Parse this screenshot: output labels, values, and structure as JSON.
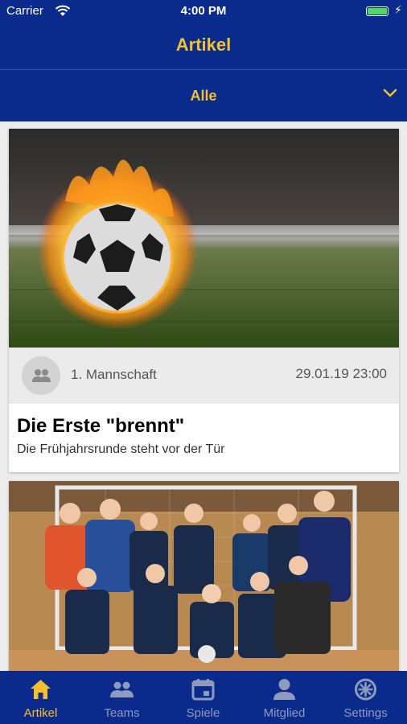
{
  "status": {
    "carrier": "Carrier",
    "time": "4:00 PM",
    "battery_level": 1.0
  },
  "nav": {
    "title": "Artikel"
  },
  "filter": {
    "selected": "Alle"
  },
  "articles": [
    {
      "team": "1. Mannschaft",
      "date": "29.01.19 23:00",
      "title": "Die Erste \"brennt\"",
      "subtitle": "Die Frühjahrsrunde steht vor der Tür"
    }
  ],
  "tabs": [
    {
      "label": "Artikel",
      "icon": "home-icon",
      "active": true
    },
    {
      "label": "Teams",
      "icon": "teams-icon",
      "active": false
    },
    {
      "label": "Spiele",
      "icon": "calendar-icon",
      "active": false
    },
    {
      "label": "Mitglied",
      "icon": "person-icon",
      "active": false
    },
    {
      "label": "Settings",
      "icon": "gear-icon",
      "active": false
    }
  ],
  "colors": {
    "bar": "#0a2a8c",
    "accent": "#f5c02c",
    "inactive": "#8e9bbd"
  }
}
